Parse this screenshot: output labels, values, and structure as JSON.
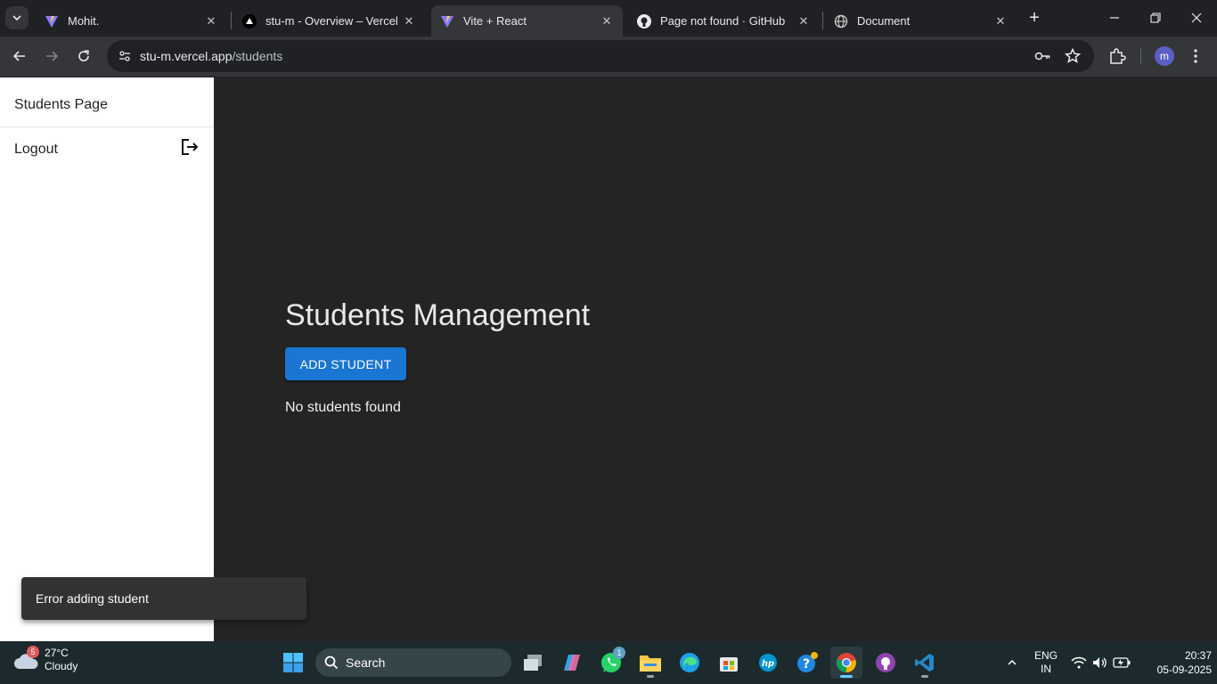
{
  "browser": {
    "tabs": [
      {
        "title": "Mohit.",
        "favicon": "vite-logo",
        "active": false
      },
      {
        "title": "stu-m - Overview – Vercel",
        "favicon": "vercel-logo",
        "active": false
      },
      {
        "title": "Vite + React",
        "favicon": "vite-logo",
        "active": true
      },
      {
        "title": "Page not found · GitHub",
        "favicon": "github-logo",
        "active": false
      },
      {
        "title": "Document",
        "favicon": "globe-icon",
        "active": false
      }
    ],
    "url_host": "stu-m.vercel.app",
    "url_path": "/students",
    "profile_initial": "m"
  },
  "sidebar": {
    "items": [
      {
        "label": "Students Page"
      },
      {
        "label": "Logout",
        "icon": "logout-icon"
      }
    ]
  },
  "main": {
    "title": "Students Management",
    "add_button": "ADD STUDENT",
    "empty_message": "No students found"
  },
  "snackbar": {
    "message": "Error adding student"
  },
  "taskbar": {
    "weather_temp": "27°C",
    "weather_desc": "Cloudy",
    "weather_badge": "5",
    "search_placeholder": "Search",
    "whatsapp_badge": "1",
    "lang_line1": "ENG",
    "lang_line2": "IN",
    "time": "20:37",
    "date": "05-09-2025"
  },
  "colors": {
    "accent": "#1976d2",
    "page_bg": "#242424",
    "sidebar_bg": "#ffffff",
    "snackbar_bg": "#323232"
  }
}
